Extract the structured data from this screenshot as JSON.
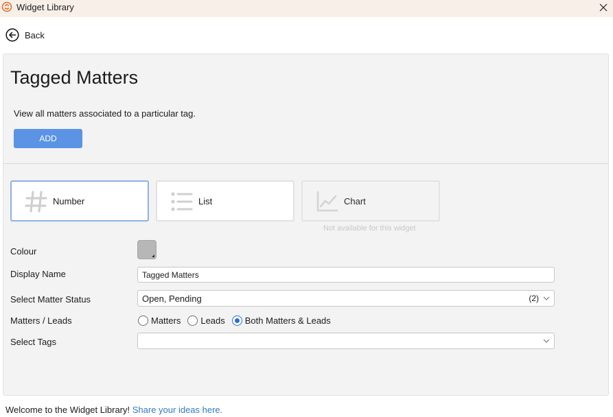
{
  "window": {
    "title": "Widget Library",
    "logo_icon": "app-logo-icon",
    "close_icon": "close-icon"
  },
  "nav": {
    "back_label": "Back",
    "back_icon": "back-arrow-icon"
  },
  "widget": {
    "title": "Tagged Matters",
    "description": "View all matters associated to a particular tag.",
    "add_label": "ADD"
  },
  "display_types": [
    {
      "label": "Number",
      "icon": "hash-icon",
      "selected": true,
      "available": true
    },
    {
      "label": "List",
      "icon": "list-icon",
      "selected": false,
      "available": true
    },
    {
      "label": "Chart",
      "icon": "line-chart-icon",
      "selected": false,
      "available": false
    }
  ],
  "unavailable_note": "Not available for this widget",
  "form": {
    "colour": {
      "label": "Colour",
      "value": "#b7b7b7"
    },
    "display_name": {
      "label": "Display Name",
      "value": "Tagged Matters"
    },
    "matter_status": {
      "label": "Select Matter Status",
      "value": "Open, Pending",
      "count": "(2)"
    },
    "matters_leads": {
      "label": "Matters / Leads",
      "options": [
        "Matters",
        "Leads",
        "Both Matters & Leads"
      ],
      "selected": "Both Matters & Leads"
    },
    "tags": {
      "label": "Select Tags",
      "value": ""
    }
  },
  "footer": {
    "text": "Welcome to the Widget Library!",
    "link": "Share your ideas here."
  },
  "colors": {
    "accent": "#5b93e5",
    "selected_border": "#8fb1e3",
    "link": "#2f7ac7",
    "titlebar": "#f8efe9",
    "panel": "#f3f3f3"
  }
}
